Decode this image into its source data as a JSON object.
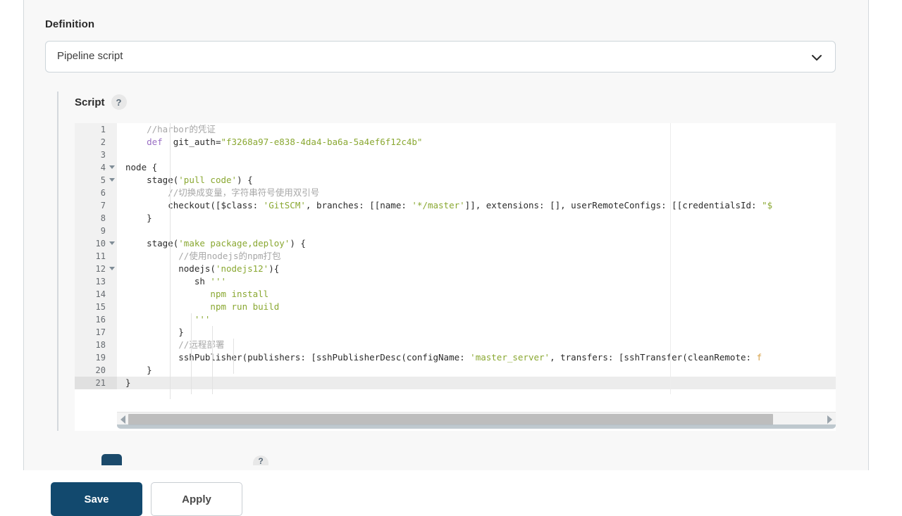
{
  "definition": {
    "label": "Definition",
    "select": {
      "value": "Pipeline script",
      "chevron_icon": "chevron-down-icon"
    }
  },
  "script_section": {
    "title": "Script",
    "help_icon": "?",
    "ruler_enabled": true,
    "active_line": 21,
    "editor": {
      "lines": [
        {
          "n": 1,
          "fold": false,
          "tokens": [
            {
              "t": "    ",
              "c": ""
            },
            {
              "t": "//harbor的凭证",
              "c": "t-com"
            }
          ]
        },
        {
          "n": 2,
          "fold": false,
          "tokens": [
            {
              "t": "    ",
              "c": ""
            },
            {
              "t": "def",
              "c": "t-kw"
            },
            {
              "t": "  git_auth=",
              "c": ""
            },
            {
              "t": "\"f3268a97-e838-4da4-ba6a-5a4ef6f12c4b\"",
              "c": "t-str"
            }
          ]
        },
        {
          "n": 3,
          "fold": false,
          "tokens": []
        },
        {
          "n": 4,
          "fold": true,
          "tokens": [
            {
              "t": "node {",
              "c": ""
            }
          ]
        },
        {
          "n": 5,
          "fold": true,
          "tokens": [
            {
              "t": "    stage(",
              "c": ""
            },
            {
              "t": "'pull code'",
              "c": "t-str"
            },
            {
              "t": ") {",
              "c": ""
            }
          ]
        },
        {
          "n": 6,
          "fold": false,
          "tokens": [
            {
              "t": "        ",
              "c": ""
            },
            {
              "t": "//切换成变量，字符串符号使用双引号",
              "c": "t-com"
            }
          ]
        },
        {
          "n": 7,
          "fold": false,
          "tokens": [
            {
              "t": "        checkout([$class: ",
              "c": ""
            },
            {
              "t": "'GitSCM'",
              "c": "t-str"
            },
            {
              "t": ", branches: [[name: ",
              "c": ""
            },
            {
              "t": "'*/master'",
              "c": "t-str"
            },
            {
              "t": "]], extensions: [], userRemoteConfigs: [[credentialsId: ",
              "c": ""
            },
            {
              "t": "\"$",
              "c": "t-str"
            }
          ]
        },
        {
          "n": 8,
          "fold": false,
          "tokens": [
            {
              "t": "    }",
              "c": ""
            }
          ]
        },
        {
          "n": 9,
          "fold": false,
          "tokens": []
        },
        {
          "n": 10,
          "fold": true,
          "tokens": [
            {
              "t": "    stage(",
              "c": ""
            },
            {
              "t": "'make package,deploy'",
              "c": "t-str"
            },
            {
              "t": ") {",
              "c": ""
            }
          ]
        },
        {
          "n": 11,
          "fold": false,
          "tokens": [
            {
              "t": "          ",
              "c": ""
            },
            {
              "t": "//使用nodejs的npm打包",
              "c": "t-com"
            }
          ]
        },
        {
          "n": 12,
          "fold": true,
          "tokens": [
            {
              "t": "          nodejs(",
              "c": ""
            },
            {
              "t": "'nodejs12'",
              "c": "t-str"
            },
            {
              "t": "){",
              "c": ""
            }
          ]
        },
        {
          "n": 13,
          "fold": false,
          "tokens": [
            {
              "t": "             sh ",
              "c": ""
            },
            {
              "t": "'''",
              "c": "t-str"
            }
          ]
        },
        {
          "n": 14,
          "fold": false,
          "tokens": [
            {
              "t": "                ",
              "c": ""
            },
            {
              "t": "npm install",
              "c": "t-str"
            }
          ]
        },
        {
          "n": 15,
          "fold": false,
          "tokens": [
            {
              "t": "                ",
              "c": ""
            },
            {
              "t": "npm run build",
              "c": "t-str"
            }
          ]
        },
        {
          "n": 16,
          "fold": false,
          "tokens": [
            {
              "t": "             ",
              "c": ""
            },
            {
              "t": "'''",
              "c": "t-str"
            }
          ]
        },
        {
          "n": 17,
          "fold": false,
          "tokens": [
            {
              "t": "          }",
              "c": ""
            }
          ]
        },
        {
          "n": 18,
          "fold": false,
          "tokens": [
            {
              "t": "          ",
              "c": ""
            },
            {
              "t": "//远程部署",
              "c": "t-com"
            }
          ]
        },
        {
          "n": 19,
          "fold": false,
          "tokens": [
            {
              "t": "          sshPublisher(publishers: [sshPublisherDesc(configName: ",
              "c": ""
            },
            {
              "t": "'master_server'",
              "c": "t-str"
            },
            {
              "t": ", transfers: [sshTransfer(cleanRemote: ",
              "c": ""
            },
            {
              "t": "f",
              "c": "t-num"
            }
          ]
        },
        {
          "n": 20,
          "fold": false,
          "tokens": [
            {
              "t": "    }",
              "c": ""
            }
          ]
        },
        {
          "n": 21,
          "fold": false,
          "tokens": [
            {
              "t": "}",
              "c": ""
            }
          ]
        }
      ],
      "scrollbar": {
        "left_arrow_icon": "arrow-left-icon",
        "right_arrow_icon": "arrow-right-icon"
      }
    }
  },
  "clipped_controls": {
    "checkbox_name": "checkbox",
    "help_icon": "?"
  },
  "footer": {
    "save_label": "Save",
    "apply_label": "Apply"
  },
  "colors": {
    "save_button": "#12496e",
    "panel_bg": "#f8f8f8",
    "comment": "#a7a7a7",
    "keyword": "#9a6fc4",
    "string": "#8aa832",
    "number": "#d8a34b"
  }
}
